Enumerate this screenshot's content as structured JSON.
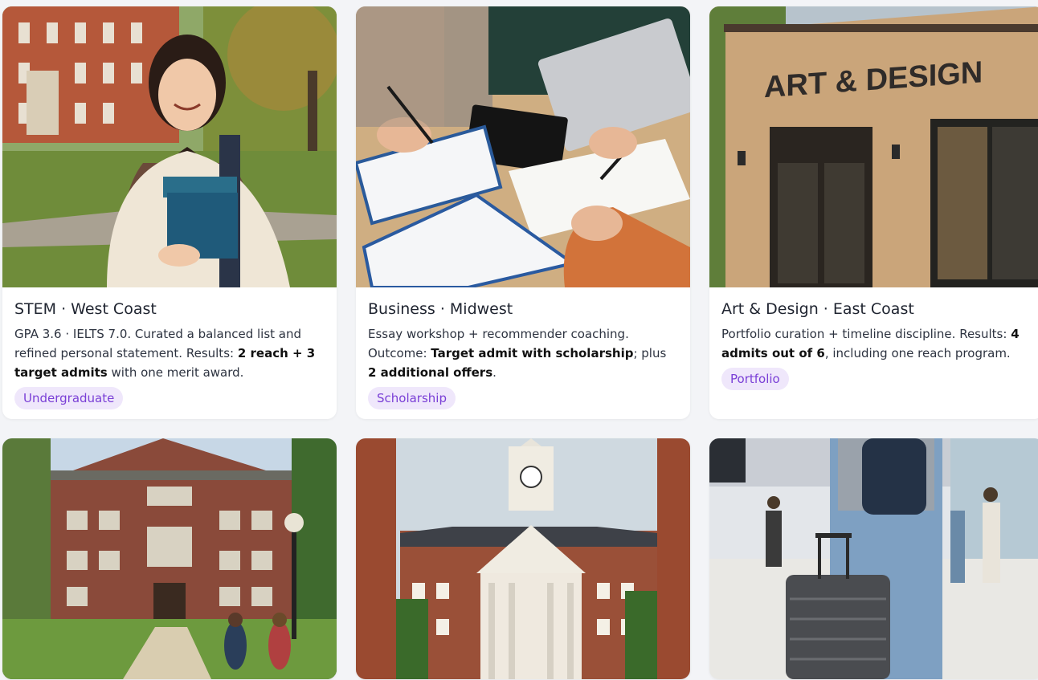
{
  "cards": [
    {
      "title": "STEM · West Coast",
      "desc_parts": [
        "GPA 3.6 · IELTS 7.0. Curated a balanced list and refined personal statement. Results: ",
        "2 reach + 3 target admits",
        " with one merit award."
      ],
      "tag": "Undergraduate",
      "image": "student-with-books-campus"
    },
    {
      "title": "Business · Midwest",
      "desc_parts": [
        "Essay workshop + recommender coaching. Outcome: ",
        "Target admit with scholarship",
        "; plus ",
        "2 additional offers",
        "."
      ],
      "tag": "Scholarship",
      "image": "application-paperwork-desk"
    },
    {
      "title": "Art & Design · East Coast",
      "desc_parts": [
        "Portfolio curation + timeline discipline. Results: ",
        "4 admits out of 6",
        ", including one reach program."
      ],
      "tag": "Portfolio",
      "image": "art-design-building",
      "building_sign": "ART & DESIGN"
    },
    {
      "image": "brick-university-hall-students"
    },
    {
      "image": "clock-tower-college-building"
    },
    {
      "image": "airport-traveler-suitcase"
    }
  ],
  "colors": {
    "page_bg": "#f3f4f7",
    "tag_bg": "#efe7fb",
    "tag_text": "#7a3fd6"
  }
}
